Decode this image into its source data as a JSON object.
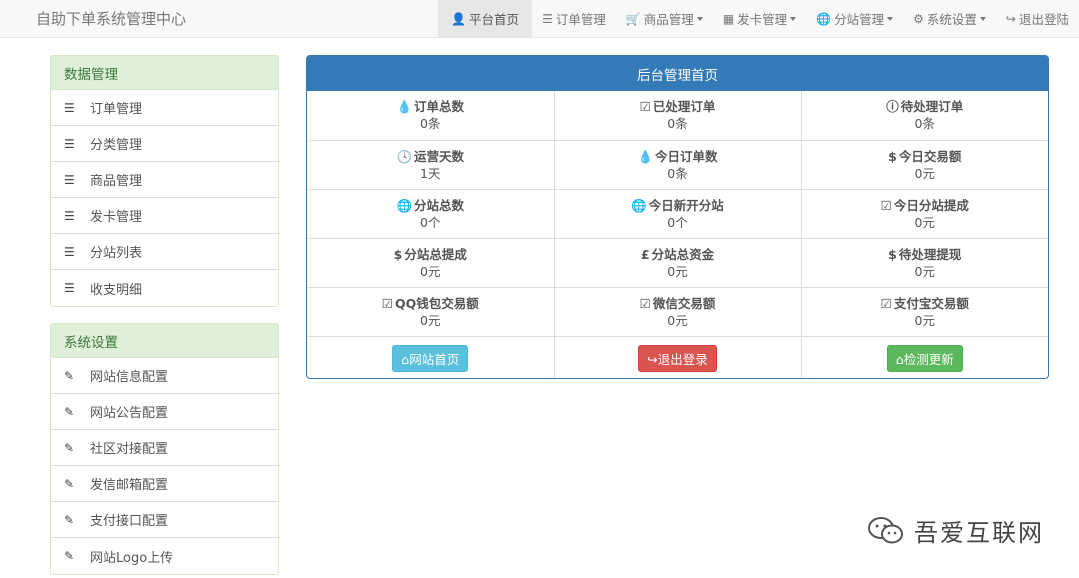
{
  "brand": "自助下单系统管理中心",
  "nav": [
    {
      "icon": "user-icon",
      "glyph": "👤",
      "label": "平台首页",
      "active": true,
      "dropdown": false
    },
    {
      "icon": "list-icon",
      "glyph": "☰",
      "label": "订单管理",
      "active": false,
      "dropdown": false
    },
    {
      "icon": "cart-icon",
      "glyph": "🛒",
      "label": "商品管理",
      "active": false,
      "dropdown": true
    },
    {
      "icon": "grid-icon",
      "glyph": "▦",
      "label": "发卡管理",
      "active": false,
      "dropdown": true
    },
    {
      "icon": "globe-icon",
      "glyph": "🌐",
      "label": "分站管理",
      "active": false,
      "dropdown": true
    },
    {
      "icon": "gear-icon",
      "glyph": "⚙",
      "label": "系统设置",
      "active": false,
      "dropdown": true
    },
    {
      "icon": "logout-icon",
      "glyph": "↪",
      "label": "退出登陆",
      "active": false,
      "dropdown": false
    }
  ],
  "data_panel": {
    "title": "数据管理",
    "items": [
      "订单管理",
      "分类管理",
      "商品管理",
      "发卡管理",
      "分站列表",
      "收支明细"
    ]
  },
  "settings_panel": {
    "title": "系统设置",
    "items": [
      "网站信息配置",
      "网站公告配置",
      "社区对接配置",
      "发信邮箱配置",
      "支付接口配置",
      "网站Logo上传"
    ]
  },
  "main": {
    "title": "后台管理首页",
    "stats": [
      [
        {
          "icon": "drop-icon",
          "glyph": "💧",
          "label": "订单总数",
          "value": "0条"
        },
        {
          "icon": "check-square-icon",
          "glyph": "☑",
          "label": "已处理订单",
          "value": "0条"
        },
        {
          "icon": "info-circle-icon",
          "glyph": "ⓘ",
          "label": "待处理订单",
          "value": "0条"
        }
      ],
      [
        {
          "icon": "clock-icon",
          "glyph": "🕓",
          "label": "运营天数",
          "value": "1天"
        },
        {
          "icon": "drop-icon",
          "glyph": "💧",
          "label": "今日订单数",
          "value": "0条"
        },
        {
          "icon": "dollar-icon",
          "glyph": "$",
          "label": "今日交易额",
          "value": "0元"
        }
      ],
      [
        {
          "icon": "globe-icon",
          "glyph": "🌐",
          "label": "分站总数",
          "value": "0个"
        },
        {
          "icon": "globe-icon",
          "glyph": "🌐",
          "label": "今日新开分站",
          "value": "0个"
        },
        {
          "icon": "check-square-icon",
          "glyph": "☑",
          "label": "今日分站提成",
          "value": "0元"
        }
      ],
      [
        {
          "icon": "dollar-icon",
          "glyph": "$",
          "label": "分站总提成",
          "value": "0元"
        },
        {
          "icon": "pound-icon",
          "glyph": "£",
          "label": "分站总资金",
          "value": "0元"
        },
        {
          "icon": "dollar-icon",
          "glyph": "$",
          "label": "待处理提现",
          "value": "0元"
        }
      ],
      [
        {
          "icon": "check-square-icon",
          "glyph": "☑",
          "label": "QQ钱包交易额",
          "value": "0元"
        },
        {
          "icon": "check-square-icon",
          "glyph": "☑",
          "label": "微信交易额",
          "value": "0元"
        },
        {
          "icon": "check-square-icon",
          "glyph": "☑",
          "label": "支付宝交易额",
          "value": "0元"
        }
      ]
    ],
    "buttons": [
      {
        "icon": "home-icon",
        "glyph": "⌂",
        "label": "网站首页",
        "style": "btn-info"
      },
      {
        "icon": "logout-icon",
        "glyph": "↪",
        "label": "退出登录",
        "style": "btn-danger"
      },
      {
        "icon": "home-icon",
        "glyph": "⌂",
        "label": "检测更新",
        "style": "btn-success"
      }
    ]
  },
  "watermark": "吾爱互联网"
}
